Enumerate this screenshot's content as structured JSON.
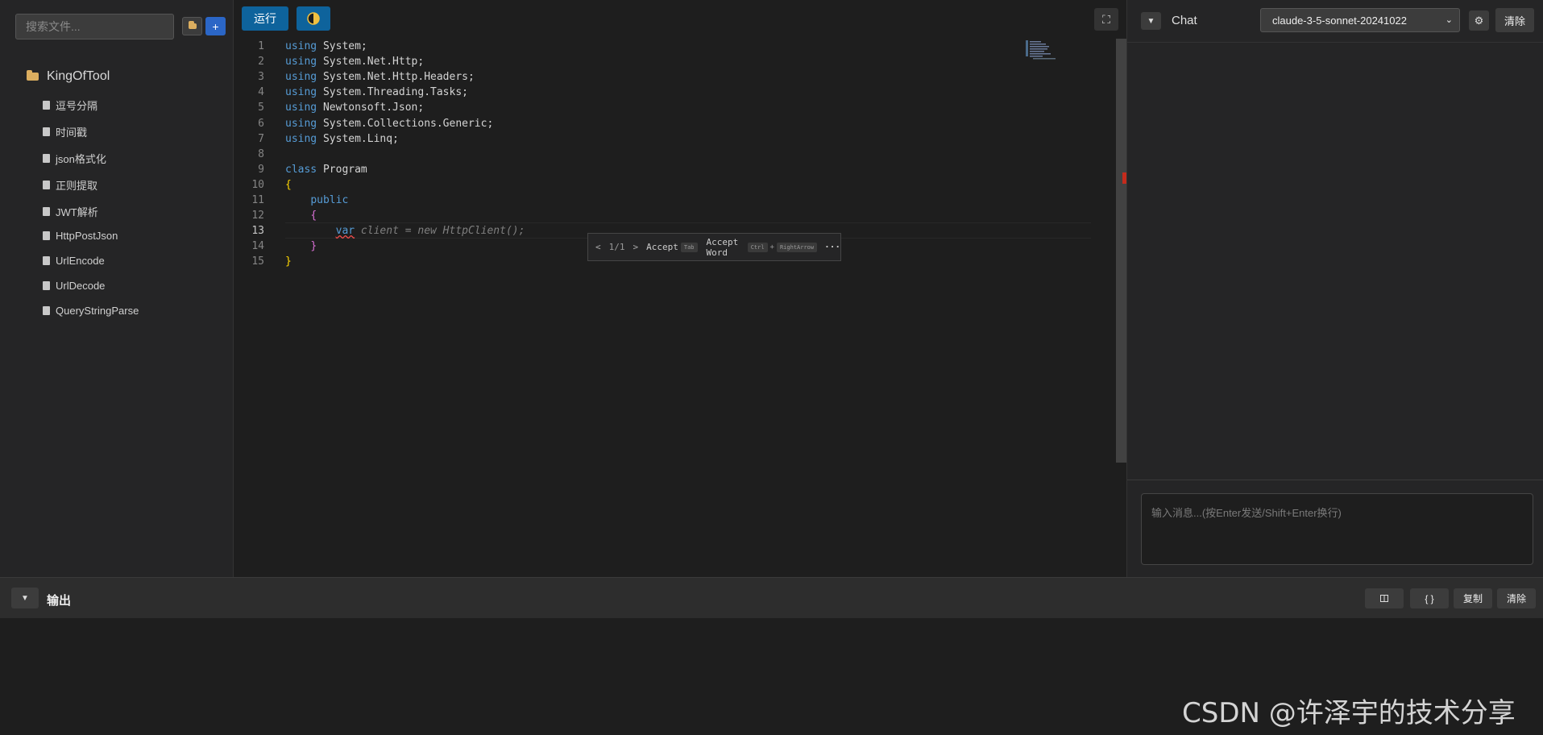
{
  "sidebar": {
    "search_placeholder": "搜索文件...",
    "add_label": "+",
    "root_folder": "KingOfTool",
    "files": [
      "逗号分隔",
      "时间戳",
      "json格式化",
      "正则提取",
      "JWT解析",
      "HttpPostJson",
      "UrlEncode",
      "UrlDecode",
      "QueryStringParse"
    ]
  },
  "toolbar": {
    "run_label": "运行"
  },
  "editor": {
    "lines": [
      {
        "n": "1",
        "t": "using System;"
      },
      {
        "n": "2",
        "t": "using System.Net.Http;"
      },
      {
        "n": "3",
        "t": "using System.Net.Http.Headers;"
      },
      {
        "n": "4",
        "t": "using System.Threading.Tasks;"
      },
      {
        "n": "5",
        "t": "using Newtonsoft.Json;"
      },
      {
        "n": "6",
        "t": "using System.Collections.Generic;"
      },
      {
        "n": "7",
        "t": "using System.Linq;"
      },
      {
        "n": "8",
        "t": ""
      },
      {
        "n": "9",
        "t": "class Program"
      },
      {
        "n": "10",
        "t": "{"
      },
      {
        "n": "11",
        "t": "    public"
      },
      {
        "n": "12",
        "t": "    {"
      },
      {
        "n": "13",
        "t": "        var"
      },
      {
        "n": "14",
        "t": "    }"
      },
      {
        "n": "15",
        "t": "}"
      }
    ],
    "active_line": "13",
    "ghost_text": " client = new HttpClient();",
    "suggestion": {
      "counter": "1/1",
      "accept": "Accept",
      "accept_key": "Tab",
      "accept_word": "Accept Word",
      "ctrl_key": "Ctrl",
      "plus": "+",
      "arrow_key": "RightArrow",
      "more": "···"
    }
  },
  "chat": {
    "title": "Chat",
    "model": "claude-3-5-sonnet-20241022",
    "clear_label": "清除",
    "input_placeholder": "输入消息...(按Enter发送/Shift+Enter换行)"
  },
  "output": {
    "title": "输出",
    "format_label": "{ }",
    "copy_label": "复制",
    "clear_label": "清除"
  },
  "watermark": "CSDN @许泽宇的技术分享",
  "colors": {
    "accent": "#0e639c",
    "add_button": "#2b66c6",
    "keyword": "#569cd6",
    "error": "#f14c4c"
  }
}
